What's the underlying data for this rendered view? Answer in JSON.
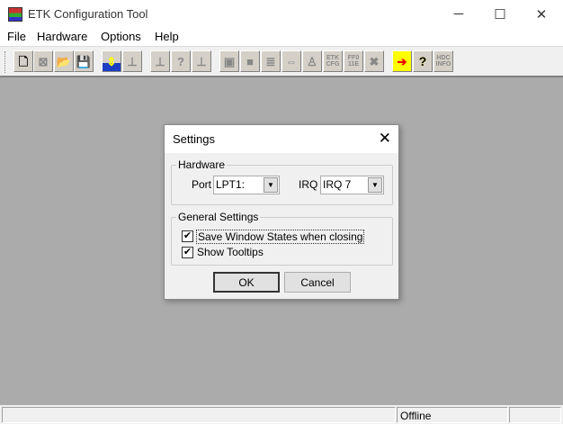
{
  "window": {
    "title": "ETK Configuration Tool",
    "minimize": "─",
    "maximize": "☐",
    "close": "✕"
  },
  "menu": [
    "File",
    "Hardware",
    "Options",
    "Help"
  ],
  "toolbar": [
    {
      "name": "new-icon",
      "label": "🗋",
      "active": true
    },
    {
      "name": "delete-icon",
      "label": "⊠",
      "active": false
    },
    {
      "name": "open-icon",
      "label": "📂",
      "active": false
    },
    {
      "name": "save-icon",
      "label": "💾",
      "active": false
    },
    {
      "name": "connect-etk-icon",
      "label": "⇕",
      "active": true
    },
    {
      "name": "etk-icon",
      "label": "⊥",
      "active": false
    },
    {
      "name": "etk-down-icon",
      "label": "⊥",
      "active": false
    },
    {
      "name": "etk-query-icon",
      "label": "?",
      "active": false
    },
    {
      "name": "etk-up-icon",
      "label": "⊥",
      "active": false
    },
    {
      "name": "window-icon",
      "label": "▣",
      "active": false
    },
    {
      "name": "block-icon",
      "label": "■",
      "active": false
    },
    {
      "name": "list-icon",
      "label": "≣",
      "active": false
    },
    {
      "name": "resize-icon",
      "label": "⇔",
      "active": false
    },
    {
      "name": "stamp-icon",
      "label": "♙",
      "active": false
    },
    {
      "name": "etk-cfg-icon",
      "label": "ETK CFG",
      "active": false
    },
    {
      "name": "ff011e-icon",
      "label": "FF0 11E",
      "active": false
    },
    {
      "name": "tools-icon",
      "label": "✖",
      "active": false
    },
    {
      "name": "exit-icon",
      "label": "➔",
      "active": true
    },
    {
      "name": "help-icon",
      "label": "?",
      "active": true
    },
    {
      "name": "hdc-info-icon",
      "label": "HDC INFO",
      "active": false
    }
  ],
  "dialog": {
    "title": "Settings",
    "close": "✕",
    "hardware": {
      "label": "Hardware",
      "port_label": "Port",
      "port_value": "LPT1:",
      "irq_label": "IRQ",
      "irq_value": "IRQ 7"
    },
    "general": {
      "label": "General Settings",
      "save_states": "Save Window States when closing",
      "show_tooltips": "Show Tooltips",
      "save_states_checked": true,
      "show_tooltips_checked": true
    },
    "ok": "OK",
    "cancel": "Cancel"
  },
  "status": {
    "state": "Offline"
  }
}
